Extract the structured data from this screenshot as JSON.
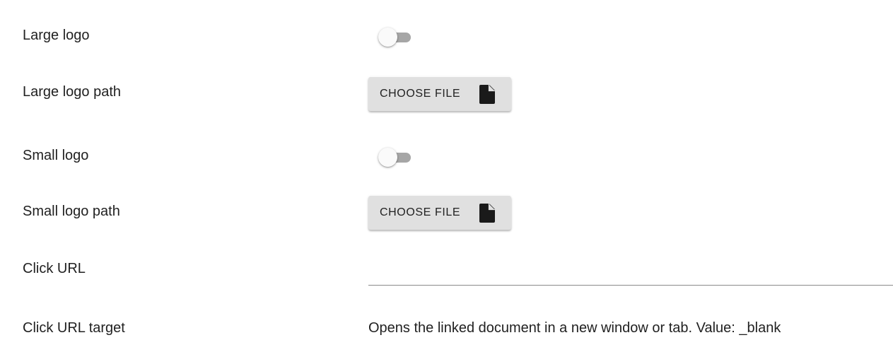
{
  "settings": {
    "large_logo": {
      "label": "Large logo",
      "enabled": false
    },
    "large_logo_path": {
      "label": "Large logo path",
      "button_label": "CHOOSE FILE",
      "button_icon": "file-icon"
    },
    "small_logo": {
      "label": "Small logo",
      "enabled": false
    },
    "small_logo_path": {
      "label": "Small logo path",
      "button_label": "CHOOSE FILE",
      "button_icon": "file-icon"
    },
    "click_url": {
      "label": "Click URL",
      "value": ""
    },
    "click_url_target": {
      "label": "Click URL target",
      "value": "Opens the linked document in a new window or tab. Value: _blank"
    }
  },
  "colors": {
    "toggle_track_off": "#a6a6a6",
    "toggle_thumb_off": "#fafafa",
    "button_bg": "#e0e0e0",
    "text": "#212121"
  }
}
